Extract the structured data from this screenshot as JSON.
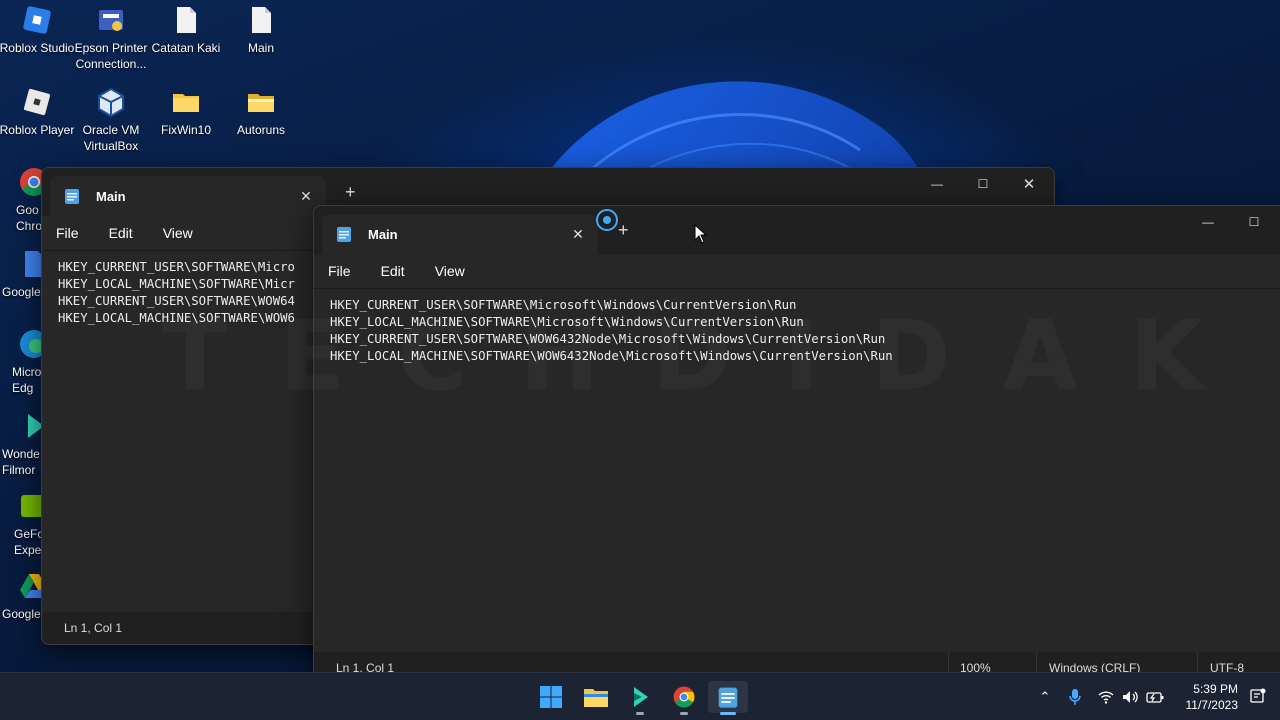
{
  "desktop": {
    "icons": [
      {
        "label": "Roblox Studio"
      },
      {
        "label": "Epson Printer Connection..."
      },
      {
        "label": "Catatan Kaki"
      },
      {
        "label": "Main"
      },
      {
        "label": "Roblox Player"
      },
      {
        "label": "Oracle VM VirtualBox"
      },
      {
        "label": "FixWin10"
      },
      {
        "label": "Autoruns"
      },
      {
        "label": "Goo Chro"
      },
      {
        "label": "Google"
      },
      {
        "label": "Micro Edg"
      },
      {
        "label": "Wonde Filmor"
      },
      {
        "label": "GeFo Experi"
      },
      {
        "label": "Google"
      }
    ]
  },
  "back_window": {
    "tab_title": "Main",
    "menu": [
      "File",
      "Edit",
      "View"
    ],
    "lines": [
      "HKEY_CURRENT_USER\\SOFTWARE\\Micro",
      "HKEY_LOCAL_MACHINE\\SOFTWARE\\Micr",
      "HKEY_CURRENT_USER\\SOFTWARE\\WOW64",
      "HKEY_LOCAL_MACHINE\\SOFTWARE\\WOW6"
    ],
    "status_position": "Ln 1, Col 1"
  },
  "front_window": {
    "tab_title": "Main",
    "menu": [
      "File",
      "Edit",
      "View"
    ],
    "lines": [
      "HKEY_CURRENT_USER\\SOFTWARE\\Microsoft\\Windows\\CurrentVersion\\Run",
      "HKEY_LOCAL_MACHINE\\SOFTWARE\\Microsoft\\Windows\\CurrentVersion\\Run",
      "HKEY_CURRENT_USER\\SOFTWARE\\WOW6432Node\\Microsoft\\Windows\\CurrentVersion\\Run",
      "HKEY_LOCAL_MACHINE\\SOFTWARE\\WOW6432Node\\Microsoft\\Windows\\CurrentVersion\\Run"
    ],
    "status": {
      "position": "Ln 1, Col 1",
      "zoom": "100%",
      "line_ending": "Windows (CRLF)",
      "encoding": "UTF-8"
    }
  },
  "watermark": "TECHDIDAK",
  "taskbar": {
    "apps": [
      "start-icon",
      "file-explorer-icon",
      "filmora-icon",
      "chrome-icon",
      "notepad-icon"
    ],
    "clock_time": "5:39 PM",
    "clock_date": "11/7/2023"
  },
  "colors": {
    "accent": "#6cb8ff",
    "editor_bg": "#272727",
    "titlebar_bg": "#202020"
  }
}
